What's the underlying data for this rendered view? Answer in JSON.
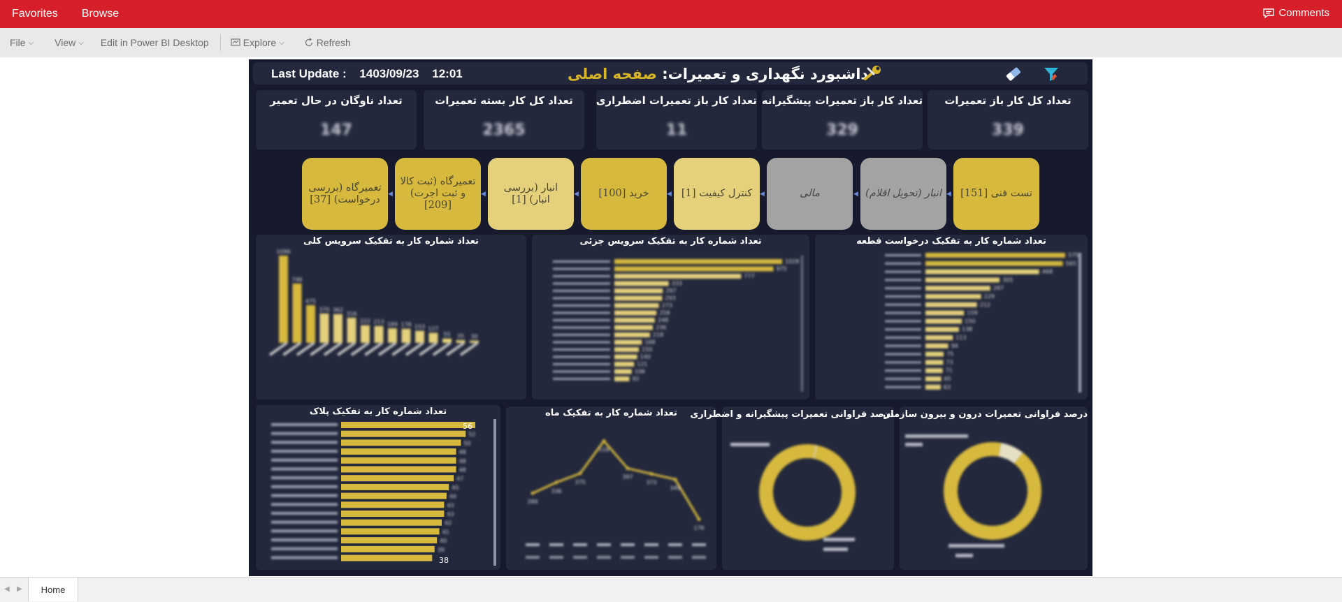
{
  "topbar": {
    "favorites": "Favorites",
    "browse": "Browse",
    "comments": "Comments"
  },
  "toolbar": {
    "file": "File",
    "view": "View",
    "edit": "Edit in Power BI Desktop",
    "explore": "Explore",
    "refresh": "Refresh"
  },
  "report": {
    "last_update_label": "Last Update :",
    "last_update_date": "1403/09/23",
    "last_update_time": "12:01",
    "title_main": "داشبورد نگهداری و تعمیرات:",
    "title_page": "صفحه اصلی",
    "kpis": [
      {
        "title": "تعداد کل کار باز تعمیرات",
        "value": "339"
      },
      {
        "title": "تعداد کار باز تعمیرات پیشگیرانه",
        "value": "329"
      },
      {
        "title": "تعداد کار باز تعمیرات اضطراری",
        "value": "11"
      },
      {
        "title": "تعداد کل کار بسته تعمیرات",
        "value": "2365"
      },
      {
        "title": "تعداد ناوگان در حال تعمیر",
        "value": "147"
      }
    ],
    "workflow": [
      {
        "label": "تست فنی [151]",
        "status": "gold"
      },
      {
        "label": "انبار (تحویل اقلام)",
        "status": "grey"
      },
      {
        "label": "مالی",
        "status": "grey"
      },
      {
        "label": "کنترل کیفیت [1]",
        "status": "light"
      },
      {
        "label": "خرید [100]",
        "status": "gold"
      },
      {
        "label": "انبار (بررسی انبار) [1]",
        "status": "light"
      },
      {
        "label": "تعمیرگاه (ثبت کالا و ثبت اجرت) [209]",
        "status": "gold"
      },
      {
        "label": "تعمیرگاه (بررسی درخواست) [37]",
        "status": "gold"
      }
    ],
    "panels": {
      "service_general": "تعداد شماره کار به تفکیک سرویس کلی",
      "service_detail": "تعداد شماره کار به تفکیک سرویس جزئی",
      "part_request": "تعداد شماره کار به تفکیک درخواست قطعه",
      "plate": "تعداد شماره کار به تفکیک پلاک",
      "month": "تعداد شماره کار به تفکیک ماه",
      "preventive_pct": "درصد فراوانی تعمیرات پیشگیرانه و اضطراری",
      "inout_pct": "درصد فراوانی تعمیرات درون و بیرون سازمان"
    },
    "plate_top_value": "56",
    "plate_bottom_value": "38",
    "colors": {
      "gold": "#d7b93e",
      "gold_light": "#e5d17c",
      "grey": "#a3a3a3",
      "canvas": "#161a2c",
      "card": "#23283c",
      "accent": "#d8b526"
    }
  },
  "chart_data": [
    {
      "type": "bar",
      "title": "تعداد شماره کار به تفکیک سرویس کلی",
      "values": [
        1096,
        746,
        475,
        370,
        362,
        316,
        222,
        213,
        184,
        178,
        153,
        127,
        55,
        35,
        30
      ]
    },
    {
      "type": "bar",
      "title": "تعداد شماره کار به تفکیک سرویس جزئی",
      "orientation": "horizontal",
      "values": [
        1028,
        975,
        777,
        333,
        297,
        293,
        273,
        258,
        248,
        236,
        218,
        168,
        150,
        140,
        121,
        106,
        92
      ]
    },
    {
      "type": "bar",
      "title": "تعداد شماره کار به تفکیک درخواست قطعه",
      "orientation": "horizontal",
      "values": [
        575,
        565,
        468,
        305,
        267,
        229,
        212,
        159,
        150,
        138,
        113,
        94,
        75,
        73,
        71,
        65,
        63
      ]
    },
    {
      "type": "bar",
      "title": "تعداد شماره کار به تفکیک پلاک",
      "orientation": "horizontal",
      "values": [
        56,
        52,
        50,
        48,
        48,
        48,
        47,
        45,
        44,
        43,
        43,
        42,
        41,
        40,
        39,
        38
      ]
    },
    {
      "type": "line",
      "title": "تعداد شماره کار به تفکیک ماه",
      "values": [
        289,
        336,
        375,
        516,
        397,
        373,
        349,
        176
      ]
    },
    {
      "type": "pie",
      "title": "درصد فراوانی تعمیرات پیشگیرانه و اضطراری",
      "values": [
        0.5,
        99.5
      ]
    },
    {
      "type": "pie",
      "title": "درصد فراوانی تعمیرات درون و بیرون سازمان",
      "values": [
        7.9,
        92.1
      ]
    }
  ]
}
